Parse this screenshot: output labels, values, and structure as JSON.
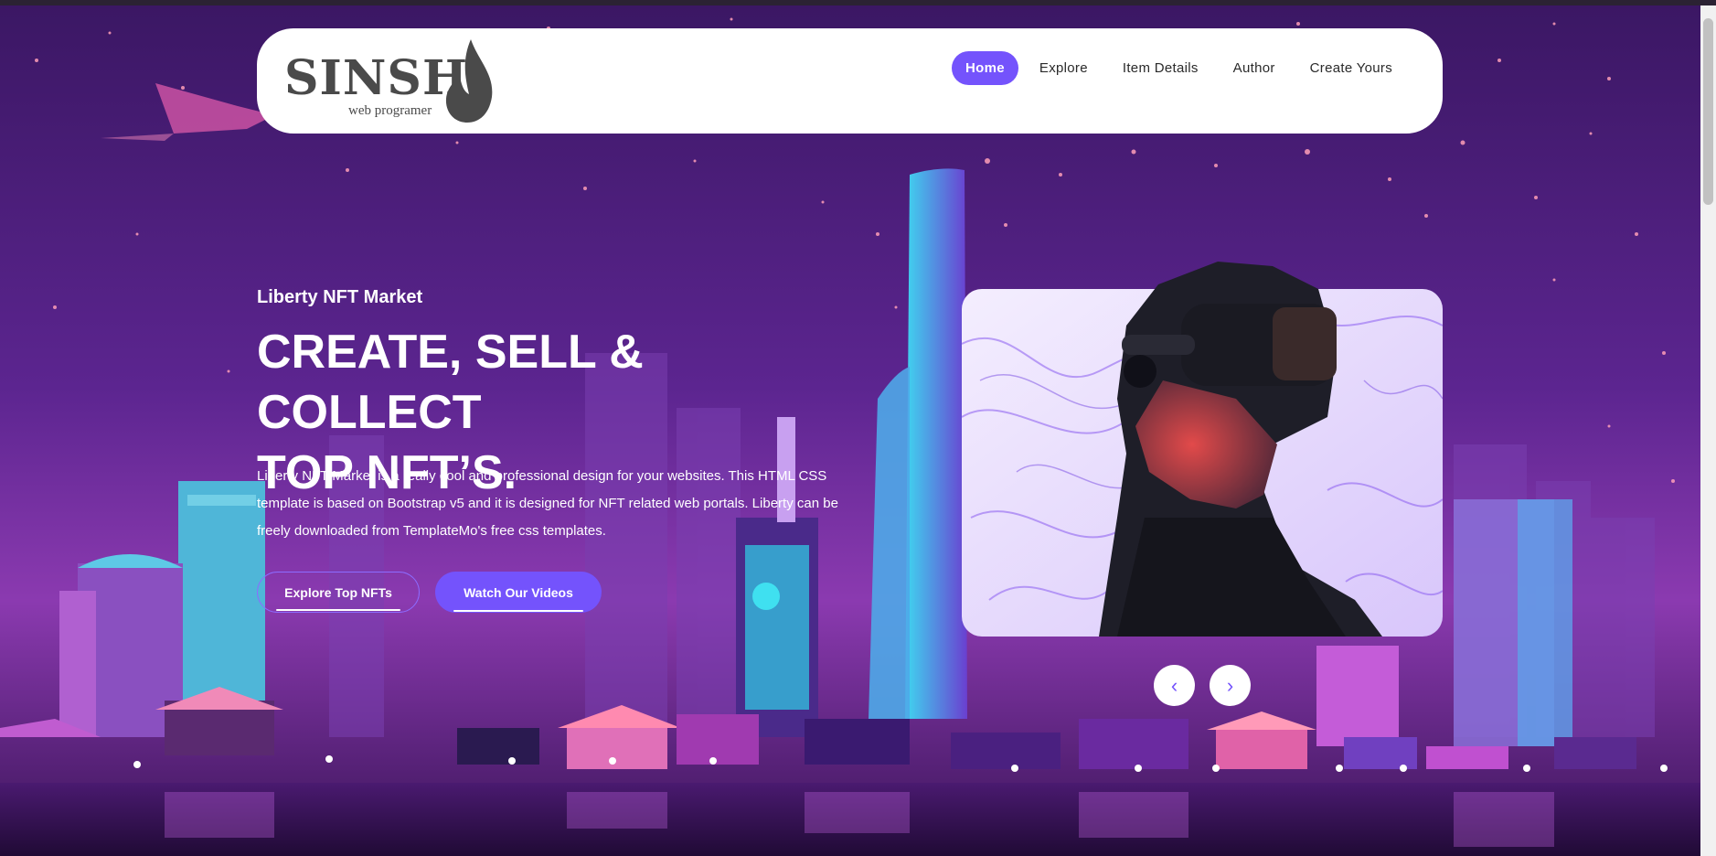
{
  "nav": {
    "logo_text": "SINSH",
    "logo_sub": "web programer",
    "items": [
      {
        "label": "Home",
        "active": true
      },
      {
        "label": "Explore",
        "active": false
      },
      {
        "label": "Item Details",
        "active": false
      },
      {
        "label": "Author",
        "active": false
      },
      {
        "label": "Create Yours",
        "active": false
      }
    ]
  },
  "hero": {
    "subtitle": "Liberty NFT Market",
    "title_line1": "CREATE, SELL & COLLECT",
    "title_line2": "TOP NFT’S.",
    "description": "Liberty NFT Market is a really cool and professional design for your websites. This HTML CSS template is based on Bootstrap v5 and it is designed for NFT related web portals. Liberty can be freely downloaded from TemplateMo's free css templates.",
    "btn_explore": "Explore Top NFTs",
    "btn_videos": "Watch Our Videos"
  },
  "carousel": {
    "prev_icon": "chevron-left-icon",
    "next_icon": "chevron-right-icon",
    "prev_glyph": "‹",
    "next_glyph": "›"
  },
  "colors": {
    "accent": "#7453fc",
    "nav_bg": "#ffffff"
  }
}
